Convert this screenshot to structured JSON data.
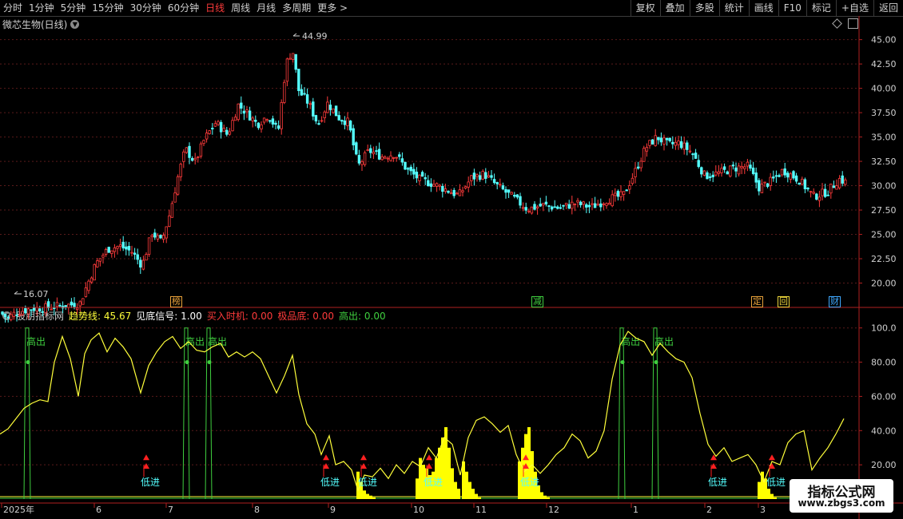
{
  "toolbar": {
    "periods": [
      "分时",
      "1分钟",
      "5分钟",
      "15分钟",
      "30分钟",
      "60分钟",
      "日线",
      "周线",
      "月线",
      "多周期",
      "更多 >"
    ],
    "active_period": "日线",
    "right_buttons": [
      "复权",
      "叠加",
      "多股",
      "统计",
      "画线",
      "F10",
      "标记",
      "+自选",
      "返回"
    ]
  },
  "main_chart": {
    "title": "微芯生物(日线)",
    "high_label": "44.99",
    "low_label": "16.07",
    "price_ticks": [
      "45.00",
      "42.50",
      "40.00",
      "37.50",
      "35.00",
      "32.50",
      "30.00",
      "27.50",
      "25.00",
      "22.50",
      "20.00"
    ],
    "ylim": [
      17.5,
      46.2
    ],
    "event_badges": [
      {
        "text": "榜",
        "color": "#e8a23a"
      },
      {
        "text": "减",
        "color": "#3fcf3f"
      },
      {
        "text": "定",
        "color": "#e8a23a"
      },
      {
        "text": "回",
        "color": "#e8d23a"
      },
      {
        "text": "财",
        "color": "#3fa8ff"
      }
    ]
  },
  "indicator": {
    "name": "股朋指标网",
    "values": [
      {
        "label": "趋势线:",
        "value": "45.67",
        "color": "#ffff3a"
      },
      {
        "label": "见底信号:",
        "value": "1.00",
        "color": "#ffffff"
      },
      {
        "label": "买入时机:",
        "value": "0.00",
        "color": "#ff3b3b"
      },
      {
        "label": "极品底:",
        "value": "0.00",
        "color": "#ff3b3b"
      },
      {
        "label": "高出:",
        "value": "0.00",
        "color": "#3fcf3f"
      }
    ],
    "ticks": [
      "100.0",
      "80.00",
      "60.00",
      "40.00",
      "20.00"
    ],
    "ylim": [
      0,
      105
    ],
    "high_label": "高出",
    "low_label": "低进"
  },
  "x_axis": {
    "labels": [
      "2025年",
      "6",
      "7",
      "8",
      "9",
      "10",
      "11",
      "12",
      "1",
      "2",
      "3"
    ]
  },
  "chart_data": [
    {
      "type": "candlestick",
      "title": "微芯生物(日线)",
      "y_range": [
        17.5,
        46.2
      ],
      "y_ticks": [
        20,
        22.5,
        25,
        27.5,
        30,
        32.5,
        35,
        37.5,
        40,
        42.5,
        45
      ],
      "x_labels": [
        "2025年",
        "6",
        "7",
        "8",
        "9",
        "10",
        "11",
        "12",
        "1",
        "2",
        "3"
      ],
      "close_series": [
        {
          "x": 0,
          "y": 17.0
        },
        {
          "x": 10,
          "y": 16.4
        },
        {
          "x": 20,
          "y": 17.0
        },
        {
          "x": 40,
          "y": 17.4
        },
        {
          "x": 60,
          "y": 17.5
        },
        {
          "x": 80,
          "y": 17.7
        },
        {
          "x": 100,
          "y": 17.9
        },
        {
          "x": 108,
          "y": 19.6
        },
        {
          "x": 120,
          "y": 22.0
        },
        {
          "x": 135,
          "y": 23.5
        },
        {
          "x": 150,
          "y": 23.8
        },
        {
          "x": 165,
          "y": 23.2
        },
        {
          "x": 178,
          "y": 21.8
        },
        {
          "x": 190,
          "y": 25.2
        },
        {
          "x": 202,
          "y": 24.2
        },
        {
          "x": 212,
          "y": 27.0
        },
        {
          "x": 222,
          "y": 30.7
        },
        {
          "x": 232,
          "y": 33.8
        },
        {
          "x": 244,
          "y": 32.4
        },
        {
          "x": 256,
          "y": 34.8
        },
        {
          "x": 270,
          "y": 36.5
        },
        {
          "x": 285,
          "y": 35.2
        },
        {
          "x": 298,
          "y": 38.3
        },
        {
          "x": 310,
          "y": 37.4
        },
        {
          "x": 322,
          "y": 36.3
        },
        {
          "x": 336,
          "y": 37.3
        },
        {
          "x": 348,
          "y": 35.5
        },
        {
          "x": 358,
          "y": 42.5
        },
        {
          "x": 366,
          "y": 44.0
        },
        {
          "x": 374,
          "y": 39.7
        },
        {
          "x": 386,
          "y": 38.5
        },
        {
          "x": 398,
          "y": 36.3
        },
        {
          "x": 410,
          "y": 38.5
        },
        {
          "x": 424,
          "y": 37.0
        },
        {
          "x": 436,
          "y": 36.5
        },
        {
          "x": 448,
          "y": 32.0
        },
        {
          "x": 462,
          "y": 33.6
        },
        {
          "x": 478,
          "y": 33.0
        },
        {
          "x": 494,
          "y": 33.3
        },
        {
          "x": 510,
          "y": 31.6
        },
        {
          "x": 526,
          "y": 30.6
        },
        {
          "x": 542,
          "y": 30.2
        },
        {
          "x": 558,
          "y": 29.6
        },
        {
          "x": 574,
          "y": 29.0
        },
        {
          "x": 590,
          "y": 30.8
        },
        {
          "x": 606,
          "y": 31.2
        },
        {
          "x": 622,
          "y": 30.0
        },
        {
          "x": 640,
          "y": 28.9
        },
        {
          "x": 660,
          "y": 27.6
        },
        {
          "x": 680,
          "y": 28.0
        },
        {
          "x": 700,
          "y": 27.7
        },
        {
          "x": 720,
          "y": 28.2
        },
        {
          "x": 740,
          "y": 27.8
        },
        {
          "x": 760,
          "y": 28.6
        },
        {
          "x": 780,
          "y": 29.0
        },
        {
          "x": 795,
          "y": 31.5
        },
        {
          "x": 808,
          "y": 33.9
        },
        {
          "x": 822,
          "y": 35.0
        },
        {
          "x": 836,
          "y": 34.2
        },
        {
          "x": 850,
          "y": 34.4
        },
        {
          "x": 866,
          "y": 33.4
        },
        {
          "x": 882,
          "y": 31.0
        },
        {
          "x": 900,
          "y": 31.3
        },
        {
          "x": 918,
          "y": 31.8
        },
        {
          "x": 936,
          "y": 32.0
        },
        {
          "x": 950,
          "y": 29.8
        },
        {
          "x": 966,
          "y": 30.5
        },
        {
          "x": 980,
          "y": 31.6
        },
        {
          "x": 1000,
          "y": 30.6
        },
        {
          "x": 1018,
          "y": 28.9
        },
        {
          "x": 1036,
          "y": 29.4
        },
        {
          "x": 1050,
          "y": 30.7
        },
        {
          "x": 1060,
          "y": 30.3
        }
      ]
    },
    {
      "type": "line",
      "title": "股朋指标网",
      "y_range": [
        0,
        105
      ],
      "y_ticks": [
        20,
        40,
        60,
        80,
        100
      ],
      "series": [
        {
          "name": "趋势线",
          "color": "#ffff3a",
          "points": [
            {
              "x": 0,
              "y": 38
            },
            {
              "x": 10,
              "y": 41
            },
            {
              "x": 20,
              "y": 47
            },
            {
              "x": 30,
              "y": 53
            },
            {
              "x": 40,
              "y": 56
            },
            {
              "x": 50,
              "y": 58
            },
            {
              "x": 60,
              "y": 57
            },
            {
              "x": 68,
              "y": 80
            },
            {
              "x": 78,
              "y": 95
            },
            {
              "x": 88,
              "y": 82
            },
            {
              "x": 98,
              "y": 60
            },
            {
              "x": 106,
              "y": 85
            },
            {
              "x": 114,
              "y": 93
            },
            {
              "x": 124,
              "y": 97
            },
            {
              "x": 134,
              "y": 86
            },
            {
              "x": 144,
              "y": 94
            },
            {
              "x": 154,
              "y": 89
            },
            {
              "x": 164,
              "y": 82
            },
            {
              "x": 176,
              "y": 62
            },
            {
              "x": 186,
              "y": 78
            },
            {
              "x": 196,
              "y": 86
            },
            {
              "x": 206,
              "y": 92
            },
            {
              "x": 216,
              "y": 95
            },
            {
              "x": 226,
              "y": 88
            },
            {
              "x": 236,
              "y": 92
            },
            {
              "x": 246,
              "y": 87
            },
            {
              "x": 256,
              "y": 86
            },
            {
              "x": 266,
              "y": 89
            },
            {
              "x": 276,
              "y": 91
            },
            {
              "x": 286,
              "y": 83
            },
            {
              "x": 296,
              "y": 86
            },
            {
              "x": 306,
              "y": 83
            },
            {
              "x": 316,
              "y": 86
            },
            {
              "x": 326,
              "y": 82
            },
            {
              "x": 336,
              "y": 72
            },
            {
              "x": 346,
              "y": 62
            },
            {
              "x": 356,
              "y": 72
            },
            {
              "x": 366,
              "y": 84
            },
            {
              "x": 374,
              "y": 61
            },
            {
              "x": 384,
              "y": 44
            },
            {
              "x": 394,
              "y": 38
            },
            {
              "x": 402,
              "y": 26
            },
            {
              "x": 412,
              "y": 37
            },
            {
              "x": 420,
              "y": 20
            },
            {
              "x": 430,
              "y": 22
            },
            {
              "x": 440,
              "y": 17
            },
            {
              "x": 448,
              "y": 5
            },
            {
              "x": 456,
              "y": 14
            },
            {
              "x": 466,
              "y": 13
            },
            {
              "x": 476,
              "y": 18
            },
            {
              "x": 486,
              "y": 12
            },
            {
              "x": 496,
              "y": 20
            },
            {
              "x": 506,
              "y": 15
            },
            {
              "x": 516,
              "y": 22
            },
            {
              "x": 526,
              "y": 19
            },
            {
              "x": 536,
              "y": 30
            },
            {
              "x": 546,
              "y": 24
            },
            {
              "x": 556,
              "y": 36
            },
            {
              "x": 566,
              "y": 32
            },
            {
              "x": 576,
              "y": 14
            },
            {
              "x": 586,
              "y": 36
            },
            {
              "x": 596,
              "y": 46
            },
            {
              "x": 606,
              "y": 48
            },
            {
              "x": 616,
              "y": 44
            },
            {
              "x": 626,
              "y": 39
            },
            {
              "x": 636,
              "y": 43
            },
            {
              "x": 646,
              "y": 26
            },
            {
              "x": 656,
              "y": 16
            },
            {
              "x": 666,
              "y": 20
            },
            {
              "x": 676,
              "y": 15
            },
            {
              "x": 686,
              "y": 20
            },
            {
              "x": 696,
              "y": 26
            },
            {
              "x": 706,
              "y": 30
            },
            {
              "x": 716,
              "y": 38
            },
            {
              "x": 726,
              "y": 34
            },
            {
              "x": 736,
              "y": 24
            },
            {
              "x": 746,
              "y": 28
            },
            {
              "x": 756,
              "y": 40
            },
            {
              "x": 766,
              "y": 70
            },
            {
              "x": 776,
              "y": 90
            },
            {
              "x": 786,
              "y": 98
            },
            {
              "x": 796,
              "y": 94
            },
            {
              "x": 806,
              "y": 92
            },
            {
              "x": 816,
              "y": 84
            },
            {
              "x": 826,
              "y": 91
            },
            {
              "x": 836,
              "y": 86
            },
            {
              "x": 846,
              "y": 82
            },
            {
              "x": 856,
              "y": 80
            },
            {
              "x": 866,
              "y": 71
            },
            {
              "x": 876,
              "y": 50
            },
            {
              "x": 886,
              "y": 32
            },
            {
              "x": 896,
              "y": 25
            },
            {
              "x": 906,
              "y": 30
            },
            {
              "x": 916,
              "y": 22
            },
            {
              "x": 926,
              "y": 24
            },
            {
              "x": 936,
              "y": 26
            },
            {
              "x": 946,
              "y": 20
            },
            {
              "x": 956,
              "y": 10
            },
            {
              "x": 966,
              "y": 22
            },
            {
              "x": 976,
              "y": 20
            },
            {
              "x": 986,
              "y": 33
            },
            {
              "x": 996,
              "y": 38
            },
            {
              "x": 1006,
              "y": 40
            },
            {
              "x": 1016,
              "y": 17
            },
            {
              "x": 1026,
              "y": 24
            },
            {
              "x": 1036,
              "y": 30
            },
            {
              "x": 1046,
              "y": 38
            },
            {
              "x": 1056,
              "y": 47
            }
          ]
        },
        {
          "name": "见底信号",
          "color": "#ffff00",
          "bars": [
            {
              "x": 448,
              "y": 16
            },
            {
              "x": 452,
              "y": 10
            },
            {
              "x": 456,
              "y": 5
            },
            {
              "x": 460,
              "y": 3
            },
            {
              "x": 464,
              "y": 2
            },
            {
              "x": 468,
              "y": 1
            },
            {
              "x": 522,
              "y": 12
            },
            {
              "x": 526,
              "y": 24
            },
            {
              "x": 530,
              "y": 20
            },
            {
              "x": 534,
              "y": 18
            },
            {
              "x": 538,
              "y": 14
            },
            {
              "x": 542,
              "y": 16
            },
            {
              "x": 546,
              "y": 24
            },
            {
              "x": 550,
              "y": 30
            },
            {
              "x": 554,
              "y": 36
            },
            {
              "x": 558,
              "y": 42
            },
            {
              "x": 562,
              "y": 30
            },
            {
              "x": 566,
              "y": 18
            },
            {
              "x": 570,
              "y": 10
            },
            {
              "x": 574,
              "y": 6
            },
            {
              "x": 580,
              "y": 22
            },
            {
              "x": 584,
              "y": 16
            },
            {
              "x": 588,
              "y": 10
            },
            {
              "x": 592,
              "y": 6
            },
            {
              "x": 596,
              "y": 3
            },
            {
              "x": 600,
              "y": 1
            },
            {
              "x": 650,
              "y": 22
            },
            {
              "x": 654,
              "y": 30
            },
            {
              "x": 658,
              "y": 38
            },
            {
              "x": 662,
              "y": 42
            },
            {
              "x": 666,
              "y": 28
            },
            {
              "x": 670,
              "y": 16
            },
            {
              "x": 674,
              "y": 8
            },
            {
              "x": 678,
              "y": 4
            },
            {
              "x": 682,
              "y": 2
            },
            {
              "x": 686,
              "y": 1
            },
            {
              "x": 950,
              "y": 10
            },
            {
              "x": 954,
              "y": 16
            },
            {
              "x": 958,
              "y": 12
            },
            {
              "x": 962,
              "y": 6
            },
            {
              "x": 966,
              "y": 3
            },
            {
              "x": 970,
              "y": 1
            }
          ]
        },
        {
          "name": "高出",
          "color": "#3fcf3f",
          "signals_x": [
            34,
            233,
            261,
            778,
            820
          ]
        },
        {
          "name": "低进",
          "color": "#ff2020",
          "signals_x": [
            183,
            408,
            455,
            537,
            658,
            893,
            966
          ]
        }
      ]
    }
  ],
  "watermark": {
    "line1": "指标公式网",
    "line2": "www.zbgs3.com"
  }
}
